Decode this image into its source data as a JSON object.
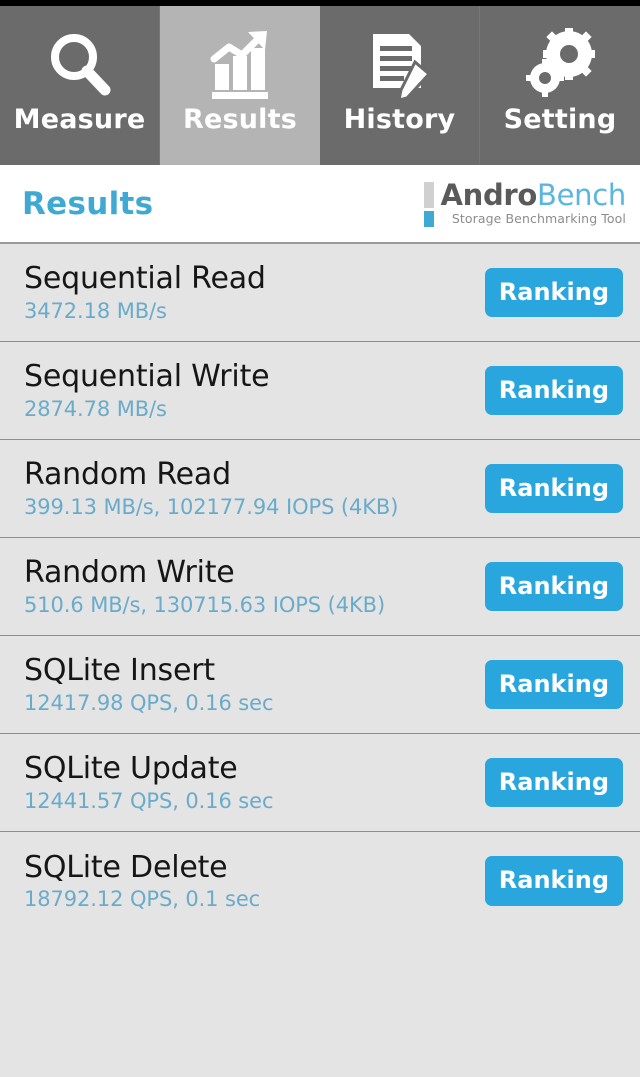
{
  "app": {
    "title": "AndroBench",
    "brand_part1": "Andro",
    "brand_part2": "Bench",
    "tagline": "Storage Benchmarking Tool",
    "accent_color": "#2aa6df",
    "value_color": "#6aabca",
    "tab_active_bg": "#b4b4b4",
    "tab_bg": "#6b6b6b"
  },
  "tabs": [
    {
      "label": "Measure",
      "icon": "magnifier-icon",
      "active": false
    },
    {
      "label": "Results",
      "icon": "bar-chart-arrow-icon",
      "active": true
    },
    {
      "label": "History",
      "icon": "document-pencil-icon",
      "active": false
    },
    {
      "label": "Setting",
      "icon": "gears-icon",
      "active": false
    }
  ],
  "header": {
    "page_title": "Results"
  },
  "results": {
    "ranking_label": "Ranking",
    "rows": [
      {
        "title": "Sequential Read",
        "value": "3472.18 MB/s"
      },
      {
        "title": "Sequential Write",
        "value": "2874.78 MB/s"
      },
      {
        "title": "Random Read",
        "value": "399.13 MB/s, 102177.94 IOPS (4KB)"
      },
      {
        "title": "Random Write",
        "value": "510.6 MB/s, 130715.63 IOPS (4KB)"
      },
      {
        "title": "SQLite Insert",
        "value": "12417.98 QPS, 0.16 sec"
      },
      {
        "title": "SQLite Update",
        "value": "12441.57 QPS, 0.16 sec"
      },
      {
        "title": "SQLite Delete",
        "value": "18792.12 QPS, 0.1 sec"
      }
    ]
  }
}
